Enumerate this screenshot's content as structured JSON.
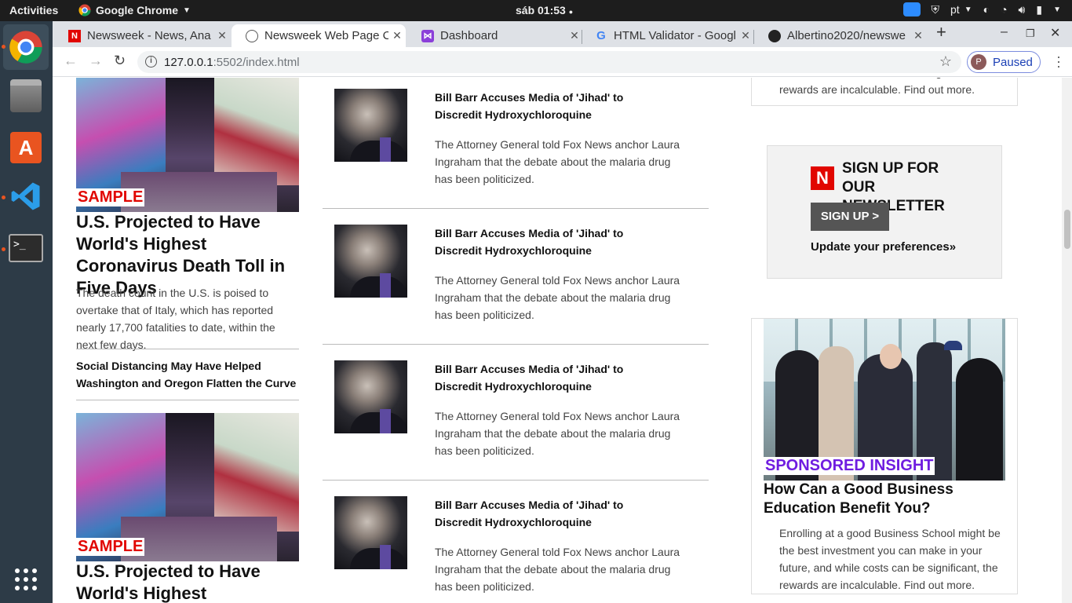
{
  "system": {
    "activities": "Activities",
    "app_name": "Google Chrome",
    "clock": "sáb 01:53",
    "keyboard": "pt"
  },
  "browser": {
    "tabs": [
      {
        "title": "Newsweek - News, Ana",
        "favicon": "N"
      },
      {
        "title": "Newsweek Web Page C",
        "favicon": "globe"
      },
      {
        "title": "Dashboard",
        "favicon": "dashboard"
      },
      {
        "title": "HTML Validator - Googl",
        "favicon": "G"
      },
      {
        "title": "Albertino2020/newswe",
        "favicon": "github"
      }
    ],
    "url_host": "127.0.0.1",
    "url_rest": ":5502/index.html",
    "profile_status": "Paused",
    "profile_initial": "P"
  },
  "left_column": {
    "sample_label": "SAMPLE",
    "main_headline": "U.S. Projected to Have World's Highest Coronavirus Death Toll in Five Days",
    "main_summary": "The death count in the U.S. is poised to overtake that of Italy, which has reported nearly 17,700 fatalities to date, within the next few days.",
    "secondary_headline": "Social Distancing May Have Helped Washington and Oregon Flatten the Curve",
    "second_sample_label": "SAMPLE",
    "second_headline": "U.S. Projected to Have World's Highest Coronavirus"
  },
  "middle_column": {
    "articles": [
      {
        "title": "Bill Barr Accuses Media of 'Jihad' to Discredit Hydroxychloroquine",
        "summary": "The Attorney General told Fox News anchor Laura Ingraham that the debate about the malaria drug has been politicized."
      },
      {
        "title": "Bill Barr Accuses Media of 'Jihad' to Discredit Hydroxychloroquine",
        "summary": "The Attorney General told Fox News anchor Laura Ingraham that the debate about the malaria drug has been politicized."
      },
      {
        "title": "Bill Barr Accuses Media of 'Jihad' to Discredit Hydroxychloroquine",
        "summary": "The Attorney General told Fox News anchor Laura Ingraham that the debate about the malaria drug has been politicized."
      },
      {
        "title": "Bill Barr Accuses Media of 'Jihad' to Discredit Hydroxychloroquine",
        "summary": "The Attorney General told Fox News anchor Laura Ingraham that the debate about the malaria drug has been politicized."
      }
    ]
  },
  "right_column": {
    "top_card_text": "future, and while costs can be significant, the rewards are incalculable. Find out more.",
    "newsletter": {
      "logo": "N",
      "title": "SIGN UP FOR OUR NEWSLETTER",
      "button": "SIGN UP >",
      "link": "Update your preferences»"
    },
    "sponsored": {
      "label": "SPONSORED INSIGHT",
      "headline": "How Can a Good Business Education Benefit You?",
      "summary": "Enrolling at a good Business School might be the best investment you can make in your future, and while costs can be significant, the rewards are incalculable. Find out more."
    }
  },
  "colors": {
    "brand_red": "#e10600",
    "sponsored_purple": "#6f1ce0",
    "dock_bg": "#2d3b47"
  }
}
